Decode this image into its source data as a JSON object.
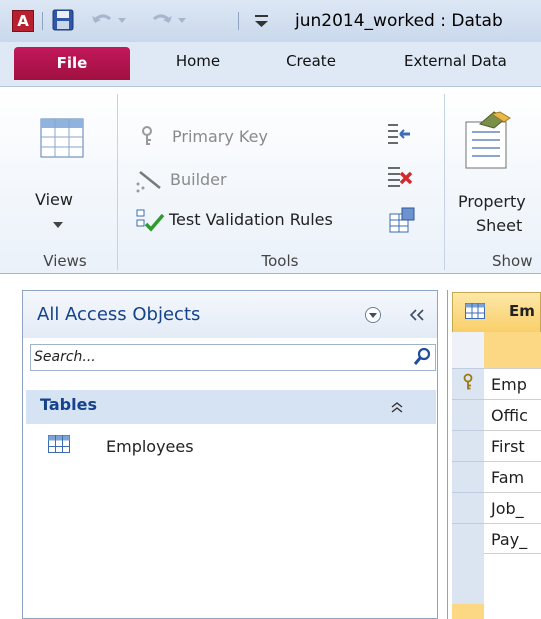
{
  "window": {
    "title": "jun2014_worked : Datab",
    "app_icon_letter": "A"
  },
  "ribbon_tabs": [
    {
      "label": "File",
      "active": true
    },
    {
      "label": "Home"
    },
    {
      "label": "Create"
    },
    {
      "label": "External Data"
    }
  ],
  "ribbon": {
    "view_label": "View",
    "views_group": "Views",
    "primary_key": "Primary Key",
    "builder": "Builder",
    "test_validation": "Test Validation Rules",
    "tools_group": "Tools",
    "property_line1": "Property",
    "property_line2": "Sheet",
    "show_group": "Show"
  },
  "nav_pane": {
    "title": "All Access Objects",
    "search_placeholder": "Search...",
    "section": "Tables",
    "items": [
      "Employees"
    ]
  },
  "document": {
    "tab_label": "Em",
    "field_names": [
      "Emp",
      "Offic",
      "First",
      "Fam",
      "Job_",
      "Pay_"
    ]
  },
  "colors": {
    "file_tab": "#b3164c",
    "access_icon": "#b8202f",
    "nav_title": "#15428b"
  }
}
